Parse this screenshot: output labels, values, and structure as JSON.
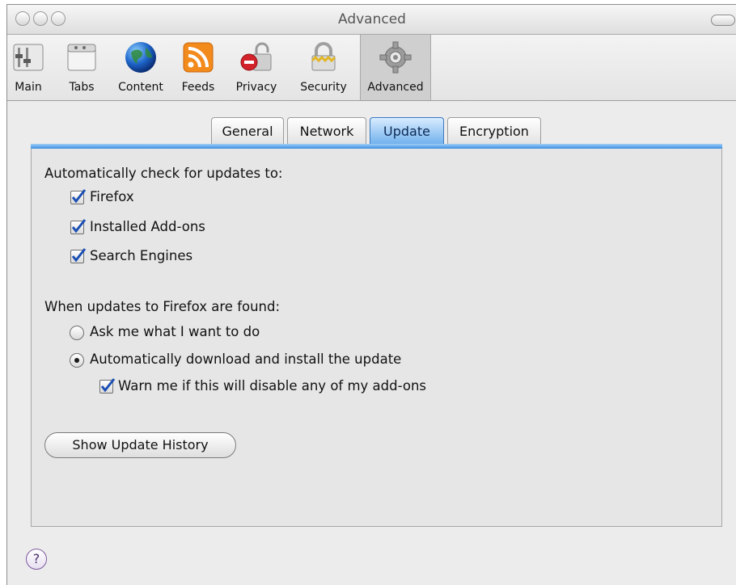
{
  "window": {
    "title": "Advanced"
  },
  "toolbar": {
    "items": [
      {
        "label": "Main",
        "icon": "switch-icon"
      },
      {
        "label": "Tabs",
        "icon": "tabs-icon"
      },
      {
        "label": "Content",
        "icon": "globe-icon"
      },
      {
        "label": "Feeds",
        "icon": "rss-icon"
      },
      {
        "label": "Privacy",
        "icon": "lock-icon"
      },
      {
        "label": "Security",
        "icon": "padlock-icon"
      },
      {
        "label": "Advanced",
        "icon": "gear-icon",
        "selected": true
      }
    ]
  },
  "tabs": [
    {
      "label": "General"
    },
    {
      "label": "Network"
    },
    {
      "label": "Update",
      "active": true
    },
    {
      "label": "Encryption"
    }
  ],
  "update": {
    "check_heading": "Automatically check for updates to:",
    "check_firefox": {
      "label": "Firefox",
      "checked": true
    },
    "check_addons": {
      "label": "Installed Add-ons",
      "checked": true
    },
    "check_search": {
      "label": "Search Engines",
      "checked": true
    },
    "found_heading": "When updates to Firefox are found:",
    "radio_ask": {
      "label": "Ask me what I want to do",
      "selected": false
    },
    "radio_auto": {
      "label": "Automatically download and install the update",
      "selected": true
    },
    "warn": {
      "label": "Warn me if this will disable any of my add-ons",
      "checked": true
    },
    "history_button": "Show Update History"
  },
  "help": {
    "symbol": "?"
  },
  "colors": {
    "accent": "#3c8ee0",
    "check": "#1b4fb4"
  }
}
